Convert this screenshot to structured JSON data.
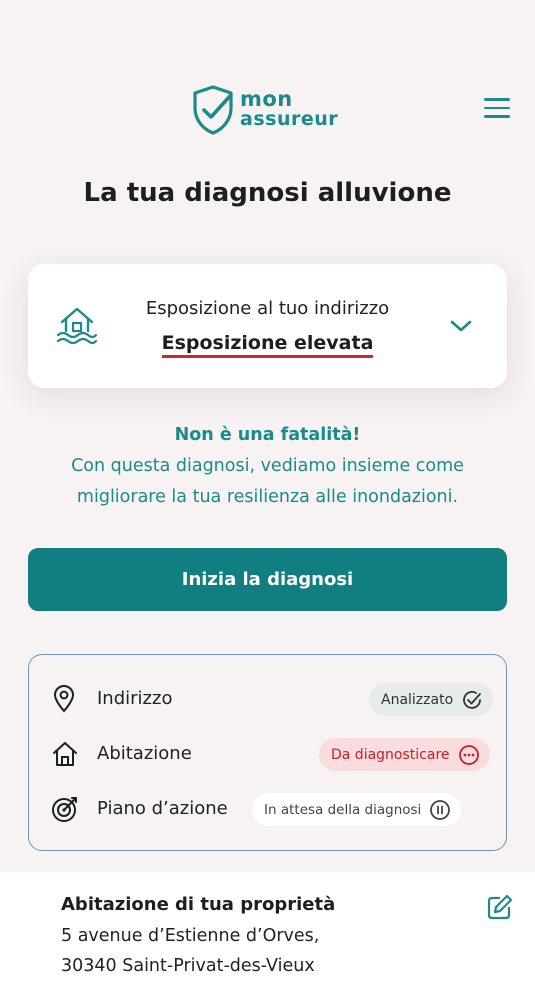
{
  "header": {
    "logo_line1": "mon",
    "logo_line2": "assureur"
  },
  "page_title": "La tua diagnosi alluvione",
  "exposure": {
    "label": "Esposizione al tuo indirizzo",
    "value": "Esposizione elevata"
  },
  "message": {
    "headline": "Non è una fatalità!",
    "line1": "Con questa diagnosi, vediamo insieme come",
    "line2": "migliorare la tua resilienza alle inondazioni."
  },
  "cta_label": "Inizia la diagnosi",
  "steps": [
    {
      "label": "Indirizzo",
      "status": "Analizzato",
      "icon": "location-pin-icon",
      "status_icon": "check-circle-icon"
    },
    {
      "label": "Abitazione",
      "status": "Da diagnosticare",
      "icon": "house-icon",
      "status_icon": "more-circle-icon"
    },
    {
      "label": "Piano d’azione",
      "status": "In attesa della diagnosi",
      "icon": "target-icon",
      "status_icon": "pause-circle-icon"
    }
  ],
  "property": {
    "title": "Abitazione di tua proprietà",
    "address_line1": "5 avenue d’Estienne d’Orves,",
    "address_line2": "30340 Saint-Privat-des-Vieux"
  },
  "colors": {
    "brand_teal": "#1a8a8c",
    "cta_bg": "#117e82",
    "alert_red": "#d2262c",
    "background": "#f7f3f3"
  }
}
